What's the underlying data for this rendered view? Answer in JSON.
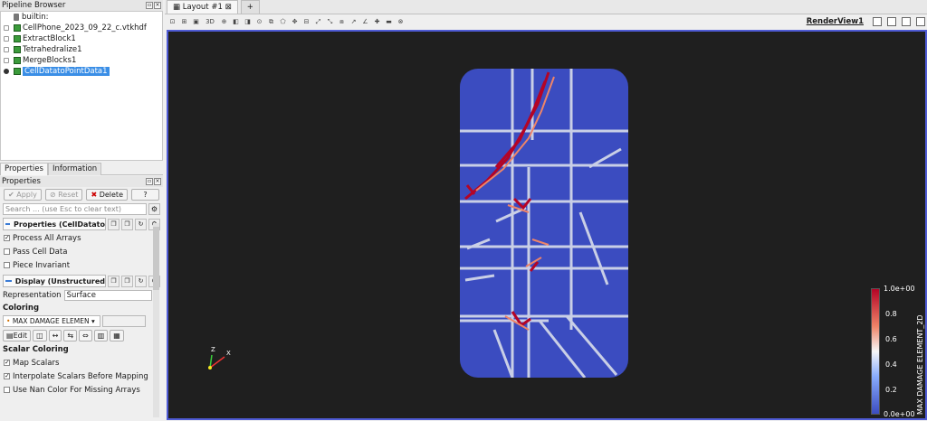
{
  "pipeline": {
    "title": "Pipeline Browser",
    "items": [
      {
        "label": "builtin:"
      },
      {
        "label": "CellPhone_2023_09_22_c.vtkhdf"
      },
      {
        "label": "ExtractBlock1"
      },
      {
        "label": "Tetrahedralize1"
      },
      {
        "label": "MergeBlocks1"
      },
      {
        "label": "CellDatatoPointData1"
      }
    ]
  },
  "tabs": [
    "Properties",
    "Information"
  ],
  "properties": {
    "title": "Properties",
    "apply": "Apply",
    "reset": "Reset",
    "delete": "Delete",
    "help": "?",
    "search_placeholder": "Search ... (use Esc to clear text)",
    "section1": "Properties (CellDatato",
    "process_all": "Process All Arrays",
    "pass_cell": "Pass Cell Data",
    "piece_invariant": "Piece Invariant",
    "section2": "Display (Unstructured",
    "representation_label": "Representation",
    "representation_value": "Surface",
    "coloring": "Coloring",
    "color_array": "MAX DAMAGE ELEMEN",
    "edit": "Edit",
    "scalar_coloring": "Scalar Coloring",
    "map_scalars": "Map Scalars",
    "interpolate": "Interpolate Scalars Before Mapping",
    "nan_color": "Use Nan Color For Missing Arrays"
  },
  "layout": {
    "tab": "Layout #1",
    "plus": "+",
    "render_view": "RenderView1",
    "toolbar_3d": "3D"
  },
  "colorbar": {
    "title": "MAX DAMAGE ELEMENT_2D",
    "ticks": [
      "1.0e+00",
      "0.8",
      "0.6",
      "0.4",
      "0.2",
      "0.0e+00"
    ]
  },
  "axes": {
    "x": "X",
    "z": "Z"
  },
  "colors": {
    "accent": "#4f5bd5",
    "mesh": "#3b4cc0",
    "crack": "#b40426",
    "background": "#1f1f1f"
  }
}
